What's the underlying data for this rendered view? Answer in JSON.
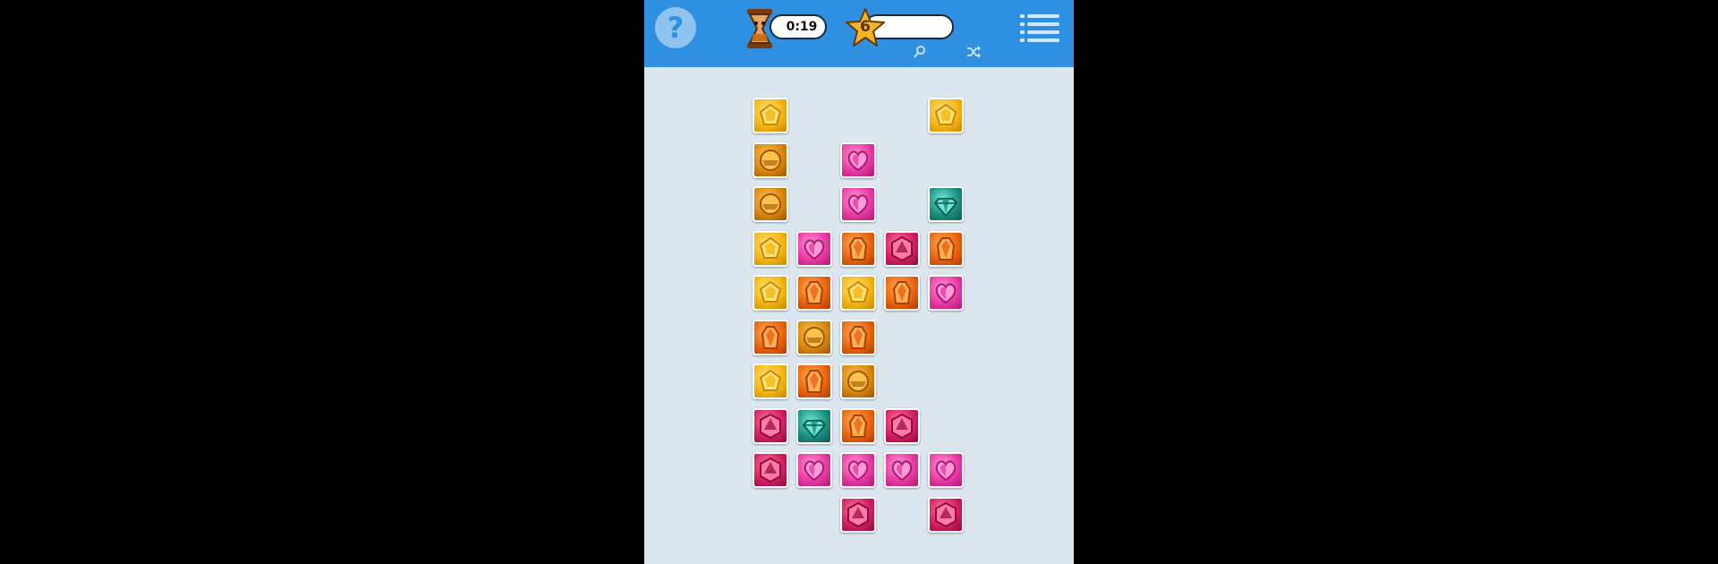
{
  "header": {
    "help_label": "?",
    "timer": "0:19",
    "level": "6"
  },
  "colors": {
    "header_bg": "#2f8fe0",
    "board_bg": "#dce6ee",
    "yellow": "#f2b712",
    "amber": "#e08a10",
    "orange": "#e86a12",
    "pink": "#e6359e",
    "crimson": "#d1205e",
    "teal": "#1a9e8a"
  },
  "gems": {
    "yellow": {
      "bg": "#f2b712",
      "dark": "#c9850a",
      "light": "#ffe27a",
      "shape": "pentagon"
    },
    "amber": {
      "bg": "#d9870f",
      "dark": "#9e5406",
      "light": "#ffc24a",
      "shape": "round"
    },
    "orange": {
      "bg": "#e8650f",
      "dark": "#b03b06",
      "light": "#ffb15a",
      "shape": "crystal"
    },
    "pink": {
      "bg": "#e83aa4",
      "dark": "#a81a72",
      "light": "#ff9ad6",
      "shape": "heart"
    },
    "crimson": {
      "bg": "#d41f62",
      "dark": "#8e0b3b",
      "light": "#ff7aa4",
      "shape": "hexagon"
    },
    "teal": {
      "bg": "#1b8f80",
      "dark": "#0b5a50",
      "light": "#6fe6d4",
      "shape": "diamond"
    }
  },
  "tiles": [
    {
      "col": 0,
      "row": 0,
      "gem": "yellow"
    },
    {
      "col": 4,
      "row": 0,
      "gem": "yellow"
    },
    {
      "col": 0,
      "row": 1,
      "gem": "amber"
    },
    {
      "col": 2,
      "row": 1,
      "gem": "pink"
    },
    {
      "col": 0,
      "row": 2,
      "gem": "amber"
    },
    {
      "col": 2,
      "row": 2,
      "gem": "pink"
    },
    {
      "col": 4,
      "row": 2,
      "gem": "teal"
    },
    {
      "col": 0,
      "row": 3,
      "gem": "yellow"
    },
    {
      "col": 1,
      "row": 3,
      "gem": "pink"
    },
    {
      "col": 2,
      "row": 3,
      "gem": "orange"
    },
    {
      "col": 3,
      "row": 3,
      "gem": "crimson"
    },
    {
      "col": 4,
      "row": 3,
      "gem": "orange"
    },
    {
      "col": 0,
      "row": 4,
      "gem": "yellow"
    },
    {
      "col": 1,
      "row": 4,
      "gem": "orange"
    },
    {
      "col": 2,
      "row": 4,
      "gem": "yellow"
    },
    {
      "col": 3,
      "row": 4,
      "gem": "orange"
    },
    {
      "col": 4,
      "row": 4,
      "gem": "pink"
    },
    {
      "col": 0,
      "row": 5,
      "gem": "orange"
    },
    {
      "col": 1,
      "row": 5,
      "gem": "amber"
    },
    {
      "col": 2,
      "row": 5,
      "gem": "orange"
    },
    {
      "col": 0,
      "row": 6,
      "gem": "yellow"
    },
    {
      "col": 1,
      "row": 6,
      "gem": "orange"
    },
    {
      "col": 2,
      "row": 6,
      "gem": "amber"
    },
    {
      "col": 0,
      "row": 7,
      "gem": "crimson"
    },
    {
      "col": 1,
      "row": 7,
      "gem": "teal"
    },
    {
      "col": 2,
      "row": 7,
      "gem": "orange"
    },
    {
      "col": 3,
      "row": 7,
      "gem": "crimson"
    },
    {
      "col": 0,
      "row": 8,
      "gem": "crimson"
    },
    {
      "col": 1,
      "row": 8,
      "gem": "pink"
    },
    {
      "col": 2,
      "row": 8,
      "gem": "pink"
    },
    {
      "col": 3,
      "row": 8,
      "gem": "pink"
    },
    {
      "col": 4,
      "row": 8,
      "gem": "pink"
    },
    {
      "col": 2,
      "row": 9,
      "gem": "crimson"
    },
    {
      "col": 4,
      "row": 9,
      "gem": "crimson"
    }
  ]
}
